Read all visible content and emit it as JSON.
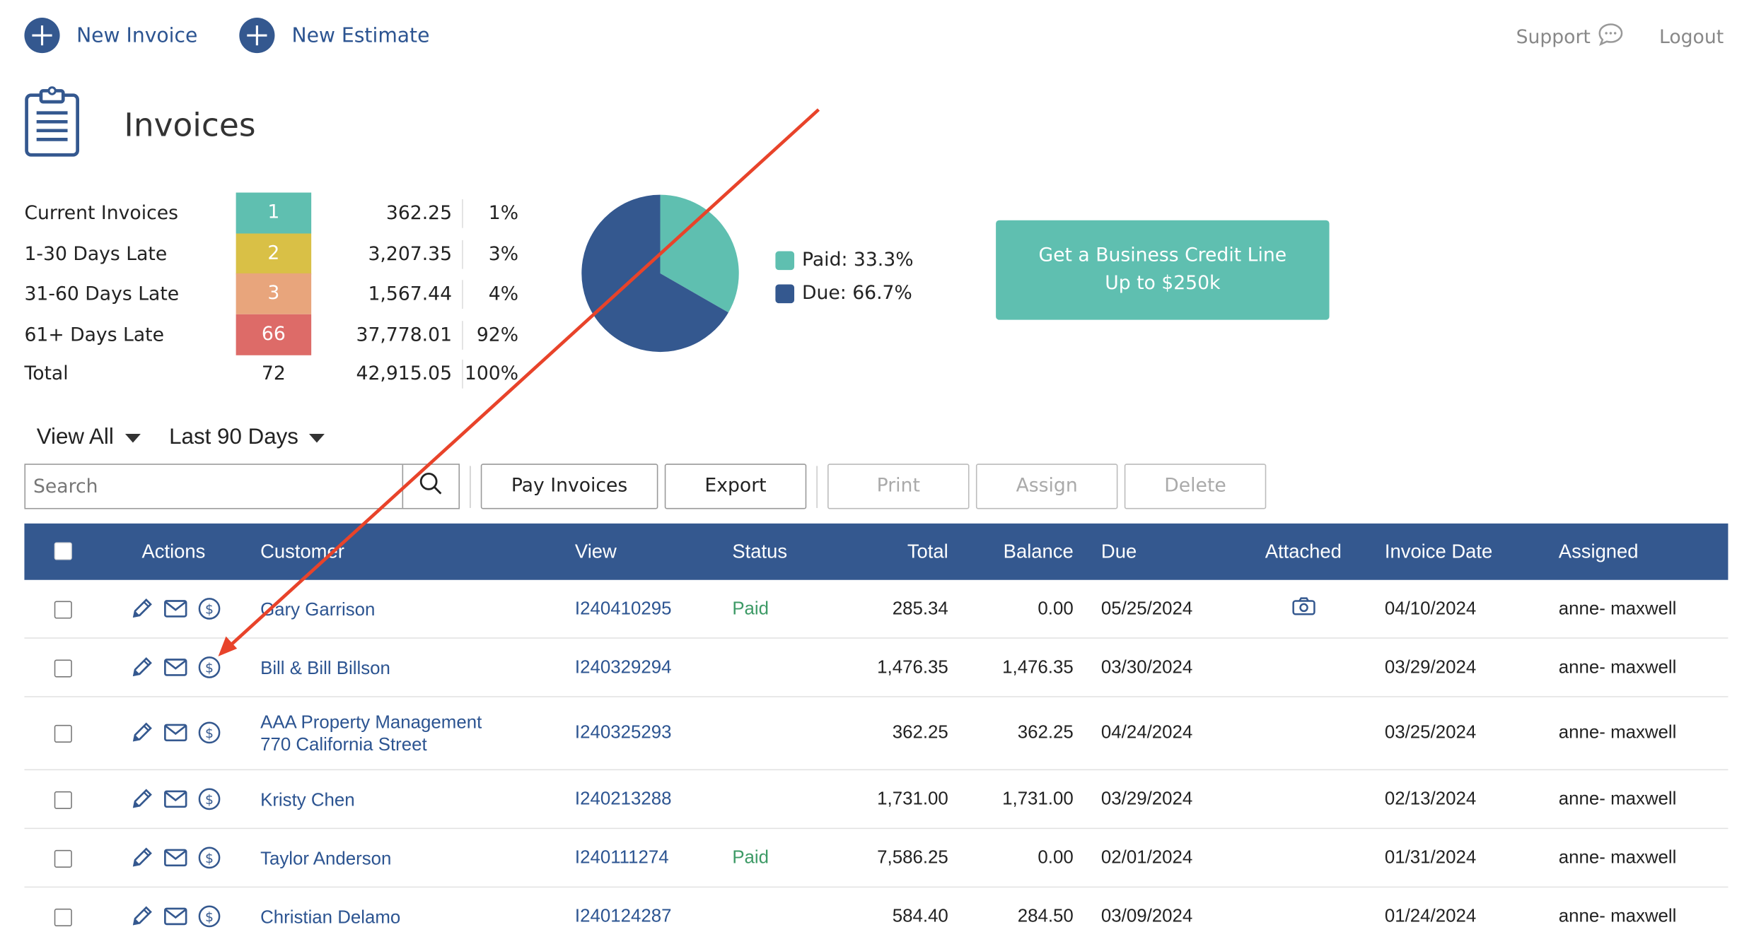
{
  "topbar": {
    "new_invoice": "New Invoice",
    "new_estimate": "New Estimate",
    "support": "Support",
    "logout": "Logout"
  },
  "page_title": "Invoices",
  "summary": {
    "rows": [
      {
        "label": "Current Invoices",
        "count": "1",
        "amount": "362.25",
        "percent": "1%",
        "color": "#5fbfb0"
      },
      {
        "label": "1-30 Days Late",
        "count": "2",
        "amount": "3,207.35",
        "percent": "3%",
        "color": "#d9c046"
      },
      {
        "label": "31-60 Days Late",
        "count": "3",
        "amount": "1,567.44",
        "percent": "4%",
        "color": "#e8a57c"
      },
      {
        "label": "61+ Days Late",
        "count": "66",
        "amount": "37,778.01",
        "percent": "92%",
        "color": "#dd6b68"
      }
    ],
    "total": {
      "label": "Total",
      "count": "72",
      "amount": "42,915.05",
      "percent": "100%"
    }
  },
  "chart_data": {
    "type": "pie",
    "slices": [
      {
        "label": "Paid: 33.3%",
        "value": 33.3,
        "color": "#5fbfb0"
      },
      {
        "label": "Due: 66.7%",
        "value": 66.7,
        "color": "#34588f"
      }
    ]
  },
  "promo": {
    "line1": "Get a Business Credit Line",
    "line2": "Up to $250k"
  },
  "filters": {
    "view": "View All",
    "range": "Last 90 Days"
  },
  "toolbar": {
    "search_placeholder": "Search",
    "pay": "Pay Invoices",
    "export": "Export",
    "print": "Print",
    "assign": "Assign",
    "delete": "Delete"
  },
  "table": {
    "columns": {
      "actions": "Actions",
      "customer": "Customer",
      "view": "View",
      "status": "Status",
      "total": "Total",
      "balance": "Balance",
      "due": "Due",
      "attached": "Attached",
      "invoice_date": "Invoice Date",
      "assigned": "Assigned"
    },
    "rows": [
      {
        "customer": "Gary Garrison",
        "customer2": "",
        "invoice": "I240410295",
        "status": "Paid",
        "total": "285.34",
        "balance": "0.00",
        "due": "05/25/2024",
        "attached": true,
        "date": "04/10/2024",
        "assigned": "anne- maxwell"
      },
      {
        "customer": "Bill & Bill Billson",
        "customer2": "",
        "invoice": "I240329294",
        "status": "",
        "total": "1,476.35",
        "balance": "1,476.35",
        "due": "03/30/2024",
        "attached": false,
        "date": "03/29/2024",
        "assigned": "anne- maxwell"
      },
      {
        "customer": "AAA Property Management",
        "customer2": "770 California Street",
        "invoice": "I240325293",
        "status": "",
        "total": "362.25",
        "balance": "362.25",
        "due": "04/24/2024",
        "attached": false,
        "date": "03/25/2024",
        "assigned": "anne- maxwell"
      },
      {
        "customer": "Kristy Chen",
        "customer2": "",
        "invoice": "I240213288",
        "status": "",
        "total": "1,731.00",
        "balance": "1,731.00",
        "due": "03/29/2024",
        "attached": false,
        "date": "02/13/2024",
        "assigned": "anne- maxwell"
      },
      {
        "customer": "Taylor Anderson",
        "customer2": "",
        "invoice": "I240111274",
        "status": "Paid",
        "total": "7,586.25",
        "balance": "0.00",
        "due": "02/01/2024",
        "attached": false,
        "date": "01/31/2024",
        "assigned": "anne- maxwell"
      },
      {
        "customer": "Christian Delamo",
        "customer2": "",
        "invoice": "I240124287",
        "status": "",
        "total": "584.40",
        "balance": "284.50",
        "due": "03/09/2024",
        "attached": false,
        "date": "01/24/2024",
        "assigned": "anne- maxwell"
      }
    ]
  },
  "annotation": {
    "color": "#e8432a"
  }
}
